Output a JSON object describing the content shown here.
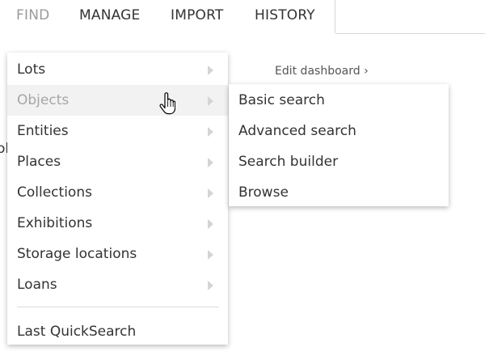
{
  "nav": {
    "tabs": [
      {
        "label": "FIND",
        "active": true
      },
      {
        "label": "MANAGE",
        "active": false
      },
      {
        "label": "IMPORT",
        "active": false
      },
      {
        "label": "HISTORY",
        "active": false
      }
    ],
    "search": {
      "value": "",
      "placeholder": ""
    }
  },
  "dashboard": {
    "edit_link": "Edit dashboard ›",
    "partial_text": "ol"
  },
  "menu": {
    "items": [
      {
        "label": "Lots",
        "has_submenu": true
      },
      {
        "label": "Objects",
        "has_submenu": true,
        "hovered": true
      },
      {
        "label": "Entities",
        "has_submenu": true
      },
      {
        "label": "Places",
        "has_submenu": true
      },
      {
        "label": "Collections",
        "has_submenu": true
      },
      {
        "label": "Exhibitions",
        "has_submenu": true
      },
      {
        "label": "Storage locations",
        "has_submenu": true
      },
      {
        "label": "Loans",
        "has_submenu": true
      }
    ],
    "footer_item": {
      "label": "Last QuickSearch"
    }
  },
  "submenu": {
    "items": [
      {
        "label": "Basic search"
      },
      {
        "label": "Advanced search"
      },
      {
        "label": "Search builder"
      },
      {
        "label": "Browse"
      }
    ]
  },
  "colors": {
    "text": "#333333",
    "active_tab": "#9a9a9a",
    "hover_bg": "#f2f2f2",
    "hover_text": "#a6a6a6",
    "arrow": "#d4d4d4",
    "divider": "#dddddd"
  },
  "icons": {
    "submenu_arrow": "chevron-right-icon",
    "cursor": "hand-pointer-icon"
  }
}
